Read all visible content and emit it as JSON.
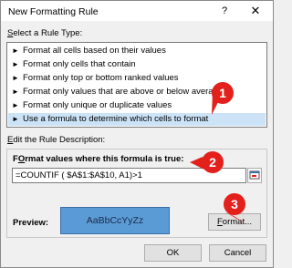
{
  "window": {
    "title": "New Formatting Rule",
    "help_glyph": "?",
    "close_glyph": "✕"
  },
  "rule_type": {
    "label_accel": "S",
    "label_rest": "elect a Rule Type:",
    "items": [
      {
        "text": "Format all cells based on their values",
        "selected": false
      },
      {
        "text": "Format only cells that contain",
        "selected": false
      },
      {
        "text": "Format only top or bottom ranked values",
        "selected": false
      },
      {
        "text": "Format only values that are above or below average",
        "selected": false
      },
      {
        "text": "Format only unique or duplicate values",
        "selected": false
      },
      {
        "text": "Use a formula to determine which cells to format",
        "selected": true
      }
    ],
    "arrow_glyph": "►"
  },
  "rule_description": {
    "label_accel": "E",
    "label_rest": "dit the Rule Description:",
    "formula_label_accel": "O",
    "formula_label_prefix": "F",
    "formula_label_rest": "rmat values where this formula is true:",
    "formula_value": "=COUNTIF ( $A$1:$A$10, A1)>1",
    "preview_label": "Preview:",
    "preview_sample": "AaBbCcYyZz",
    "format_button_accel": "F",
    "format_button_rest": "ormat..."
  },
  "buttons": {
    "ok": "OK",
    "cancel": "Cancel"
  },
  "callouts": [
    "1",
    "2",
    "3"
  ],
  "colors": {
    "callout": "#e3201b",
    "preview_fill": "#5b9bd5",
    "selected_row": "#cce3f7"
  }
}
